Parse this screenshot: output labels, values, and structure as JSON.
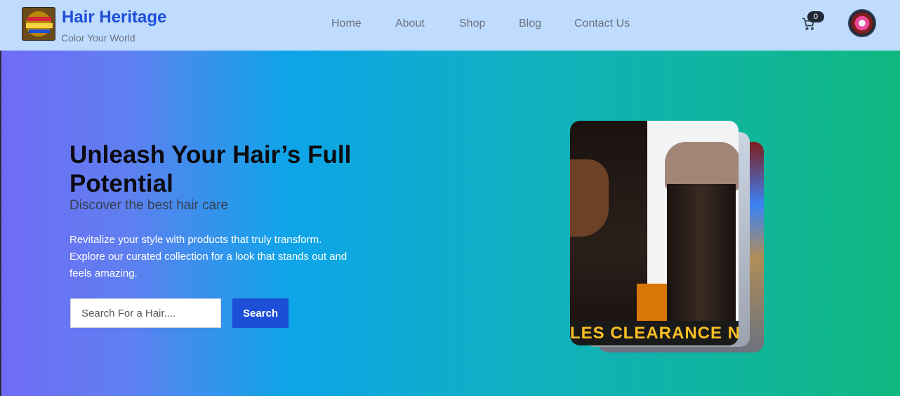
{
  "brand": {
    "title": "Hair Heritage",
    "tagline": "Color Your World"
  },
  "nav": {
    "links": [
      {
        "label": "Home"
      },
      {
        "label": "About"
      },
      {
        "label": "Shop"
      },
      {
        "label": "Blog"
      },
      {
        "label": "Contact Us"
      }
    ],
    "cart_count": "0",
    "cart_icon": "cart-icon"
  },
  "hero": {
    "title": "Unleash Your Hair’s Full Potential",
    "subtitle": "Discover the best hair care",
    "description": "Revitalize your style with products that truly transform. Explore our curated collection for a look that stands out and feels amazing.",
    "search_placeholder": "Search For a Hair....",
    "search_button": "Search",
    "banner_text": "LES CLEARANCE NOW"
  },
  "colors": {
    "navbar": "#bfdbfe",
    "brand": "#1d4ed8",
    "gradient_start": "#6f6cf6",
    "gradient_mid": "#0ea5e9",
    "gradient_end": "#10b981"
  }
}
